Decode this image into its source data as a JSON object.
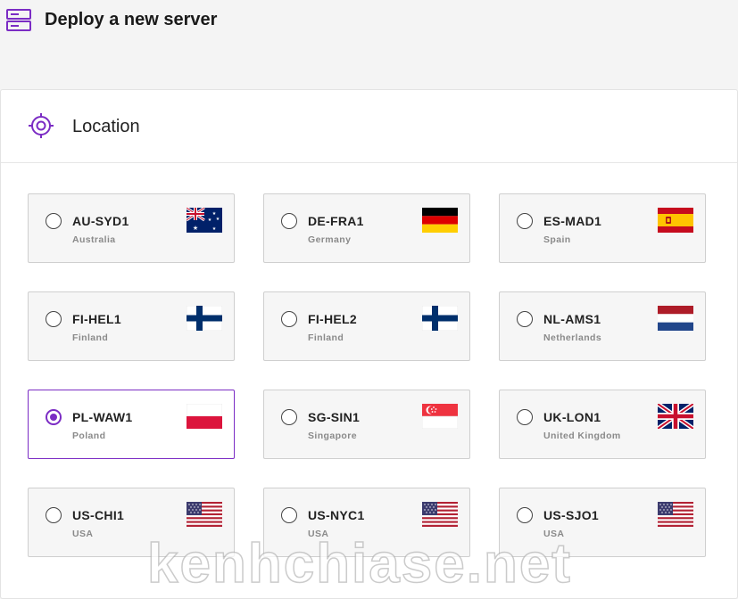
{
  "header": {
    "title": "Deploy a new server",
    "icon": "server-icon"
  },
  "location": {
    "title": "Location",
    "icon": "crosshair-icon"
  },
  "accent_color": "#7b2cc4",
  "locations": [
    {
      "code": "AU-SYD1",
      "country": "Australia",
      "flag": "australia-flag-icon",
      "selected": false
    },
    {
      "code": "DE-FRA1",
      "country": "Germany",
      "flag": "germany-flag-icon",
      "selected": false
    },
    {
      "code": "ES-MAD1",
      "country": "Spain",
      "flag": "spain-flag-icon",
      "selected": false
    },
    {
      "code": "FI-HEL1",
      "country": "Finland",
      "flag": "finland-flag-icon",
      "selected": false
    },
    {
      "code": "FI-HEL2",
      "country": "Finland",
      "flag": "finland-flag-icon",
      "selected": false
    },
    {
      "code": "NL-AMS1",
      "country": "Netherlands",
      "flag": "netherlands-flag-icon",
      "selected": false
    },
    {
      "code": "PL-WAW1",
      "country": "Poland",
      "flag": "poland-flag-icon",
      "selected": true
    },
    {
      "code": "SG-SIN1",
      "country": "Singapore",
      "flag": "singapore-flag-icon",
      "selected": false
    },
    {
      "code": "UK-LON1",
      "country": "United Kingdom",
      "flag": "uk-flag-icon",
      "selected": false
    },
    {
      "code": "US-CHI1",
      "country": "USA",
      "flag": "usa-flag-icon",
      "selected": false
    },
    {
      "code": "US-NYC1",
      "country": "USA",
      "flag": "usa-flag-icon",
      "selected": false
    },
    {
      "code": "US-SJO1",
      "country": "USA",
      "flag": "usa-flag-icon",
      "selected": false
    }
  ],
  "watermark": "kenhchiase.net"
}
